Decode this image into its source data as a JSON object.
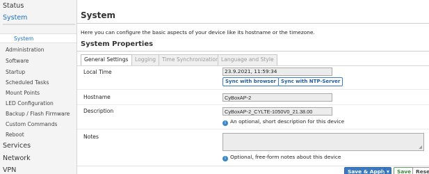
{
  "sidebar": {
    "items": [
      {
        "label": "Status"
      },
      {
        "label": "System"
      },
      {
        "label": "System"
      },
      {
        "label": "Administration"
      },
      {
        "label": "Software"
      },
      {
        "label": "Startup"
      },
      {
        "label": "Scheduled Tasks"
      },
      {
        "label": "Mount Points"
      },
      {
        "label": "LED Configuration"
      },
      {
        "label": "Backup / Flash Firmware"
      },
      {
        "label": "Custom Commands"
      },
      {
        "label": "Reboot"
      },
      {
        "label": "Services"
      },
      {
        "label": "Network"
      },
      {
        "label": "VPN"
      }
    ]
  },
  "main": {
    "title": "System",
    "description": "Here you can configure the basic aspects of your device like its hostname or the timezone.",
    "section_title": "System Properties",
    "tabs": [
      {
        "label": "General Settings"
      },
      {
        "label": "Logging"
      },
      {
        "label": "Time Synchronization"
      },
      {
        "label": "Language and Style"
      }
    ],
    "local_time": {
      "label": "Local Time",
      "value": "23.9.2021, 11:59:34",
      "sync_browser": "Sync with browser",
      "sync_ntp": "Sync with NTP-Server"
    },
    "hostname": {
      "label": "Hostname",
      "value": "CyBoxAP-2"
    },
    "description_field": {
      "label": "Description",
      "value": "CyBoxAP-2_CYLTE-1050V0_21.38.00",
      "help": "An optional, short description for this device"
    },
    "notes": {
      "label": "Notes",
      "help": "Optional, free-form notes about this device"
    }
  },
  "footer": {
    "save_apply": "Save & Apply",
    "save": "Save",
    "reset": "Rese"
  }
}
